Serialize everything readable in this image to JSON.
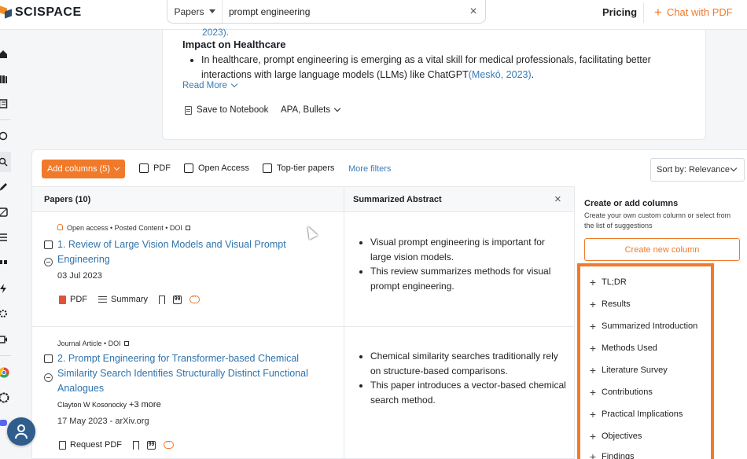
{
  "header": {
    "logo_text": "SCISPACE",
    "search_type": "Papers",
    "search_value": "prompt engineering",
    "pricing": "Pricing",
    "chat_pdf": "Chat with PDF"
  },
  "summary": {
    "cut_text": "2023).",
    "section_title": "Impact on Healthcare",
    "bullet": "In healthcare, prompt engineering is emerging as a vital skill for medical professionals, facilitating better interactions with large language models (LLMs) like ChatGPT",
    "citation": "(Meskó, 2023)",
    "bullet_end": ".",
    "read_more": "Read More",
    "save_notebook": "Save to Notebook",
    "citation_style": "APA, Bullets"
  },
  "toolbar": {
    "add_columns": "Add columns (5)",
    "filters": [
      "PDF",
      "Open Access",
      "Top-tier papers"
    ],
    "more_filters": "More filters",
    "sort": "Sort by: Relevance"
  },
  "columns": {
    "papers": "Papers (10)",
    "abstract": "Summarized Abstract"
  },
  "papers": [
    {
      "meta": "Open access • Posted Content • DOI",
      "title": "1. Review of Large Vision Models and Visual Prompt Engineering",
      "date": "03 Jul 2023",
      "actions": [
        "PDF",
        "Summary"
      ],
      "abstract": [
        "Visual prompt engineering is important for large vision models.",
        "This review summarizes methods for visual prompt engineering."
      ]
    },
    {
      "meta": "Journal Article • DOI",
      "title": "2. Prompt Engineering for Transformer-based Chemical Similarity Search Identifies Structurally Distinct Functional Analogues",
      "authors": "Clayton W Kosonocky",
      "more_authors": "+3 more",
      "date": "17 May 2023 - arXiv.org",
      "actions": [
        "Request PDF"
      ],
      "abstract": [
        "Chemical similarity searches traditionally rely on structure-based comparisons.",
        "This paper introduces a vector-based chemical search method."
      ]
    }
  ],
  "side_panel": {
    "title": "Create or add columns",
    "subtitle": "Create your own custom column or select from the list of suggestions",
    "create_button": "Create new column",
    "suggestions": [
      "TL;DR",
      "Results",
      "Summarized Introduction",
      "Methods Used",
      "Literature Survey",
      "Contributions",
      "Practical Implications",
      "Objectives",
      "Findings"
    ]
  },
  "colors": {
    "accent": "#f07a2a",
    "link": "#2f73ad",
    "brand_dark": "#2f4f6f"
  },
  "icons": [
    "home-icon",
    "library-icon",
    "notebook-icon",
    "chat-icon",
    "search-icon",
    "pen-icon",
    "extension-icon",
    "list-icon",
    "quote-icon",
    "bolt-icon",
    "settings-icon",
    "video-icon",
    "chrome-icon",
    "openai-icon",
    "discord-icon",
    "support-icon"
  ]
}
